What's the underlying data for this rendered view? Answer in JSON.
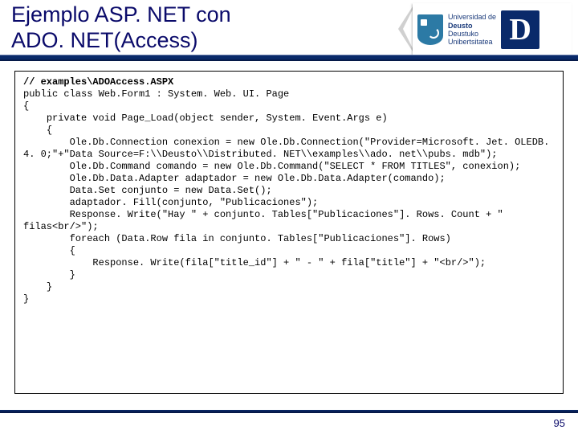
{
  "header": {
    "title_line1": "Ejemplo ASP. NET con",
    "title_line2": "ADO. NET(Access)",
    "university_line1": "Universidad de",
    "university_line2": "Deusto",
    "university_line3": "Deustuko",
    "university_line4": "Unibertsitatea",
    "logo_letter": "D"
  },
  "code": {
    "comment_path": "// examples\\ADOAccess.ASPX",
    "l1": "public class Web.Form1 : System. Web. UI. Page",
    "l2": "{",
    "l3": "    private void Page_Load(object sender, System. Event.Args e)",
    "l4": "    {",
    "l5": "        Ole.Db.Connection conexion = new Ole.Db.Connection(\"Provider=Microsoft. Jet. OLEDB. 4. 0;\"+\"Data Source=F:\\\\Deusto\\\\Distributed. NET\\\\examples\\\\ado. net\\\\pubs. mdb\");",
    "l6": "        Ole.Db.Command comando = new Ole.Db.Command(\"SELECT * FROM TITLES\", conexion);",
    "l7": "        Ole.Db.Data.Adapter adaptador = new Ole.Db.Data.Adapter(comando);",
    "l8": "        Data.Set conjunto = new Data.Set();",
    "l9": "        adaptador. Fill(conjunto, \"Publicaciones\");",
    "l10": "        Response. Write(\"Hay \" + conjunto. Tables[\"Publicaciones\"]. Rows. Count + \" filas<br/>\");",
    "l11": "        foreach (Data.Row fila in conjunto. Tables[\"Publicaciones\"]. Rows)",
    "l12": "        {",
    "l13": "            Response. Write(fila[\"title_id\"] + \" - \" + fila[\"title\"] + \"<br/>\");",
    "l14": "        }",
    "l15": "    }",
    "l16": "}"
  },
  "footer": {
    "page_number": "95"
  }
}
